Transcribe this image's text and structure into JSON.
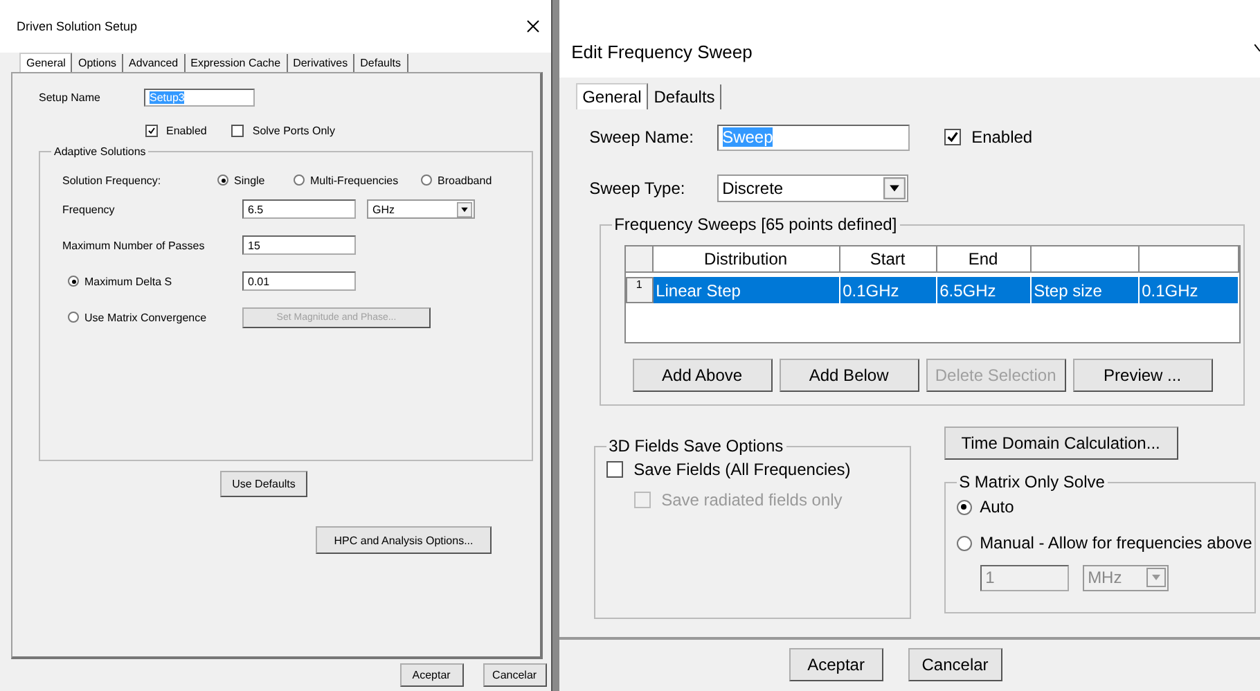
{
  "left_dialog": {
    "title": "Driven Solution Setup",
    "tabs": [
      {
        "label": "General",
        "selected": true
      },
      {
        "label": "Options",
        "selected": false
      },
      {
        "label": "Advanced",
        "selected": false
      },
      {
        "label": "Expression Cache",
        "selected": false
      },
      {
        "label": "Derivatives",
        "selected": false
      },
      {
        "label": "Defaults",
        "selected": false
      }
    ],
    "setup_name": {
      "label": "Setup Name",
      "value": "Setup3",
      "text_selected": true
    },
    "checkboxes": [
      {
        "label": "Enabled",
        "checked": true
      },
      {
        "label": "Solve Ports Only",
        "checked": false
      }
    ],
    "adaptive": {
      "title": "Adaptive Solutions",
      "solution_frequency": {
        "label": "Solution Frequency:",
        "options": [
          {
            "label": "Single",
            "selected": true
          },
          {
            "label": "Multi-Frequencies",
            "selected": false
          },
          {
            "label": "Broadband",
            "selected": false
          }
        ]
      },
      "frequency": {
        "label": "Frequency",
        "value": "6.5",
        "unit": "GHz"
      },
      "max_passes": {
        "label": "Maximum Number of Passes",
        "value": "15"
      },
      "criteria": [
        {
          "kind": "field",
          "label": "Maximum Delta S",
          "selected": true,
          "value": "0.01"
        },
        {
          "kind": "button",
          "label": "Use Matrix Convergence",
          "selected": false,
          "button": "Set Magnitude and Phase...",
          "disabled": true
        }
      ]
    },
    "use_defaults": "Use Defaults",
    "hpc": "HPC and Analysis Options...",
    "buttons": [
      "Aceptar",
      "Cancelar"
    ]
  },
  "right_dialog": {
    "title": "Edit Frequency Sweep",
    "tabs": [
      {
        "label": "General",
        "selected": true
      },
      {
        "label": "Defaults",
        "selected": false
      }
    ],
    "sweep_name": {
      "label": "Sweep Name:",
      "value": "Sweep",
      "text_selected": true
    },
    "enabled": {
      "label": "Enabled",
      "checked": true
    },
    "sweep_type": {
      "label": "Sweep Type:",
      "value": "Discrete"
    },
    "sweeps": {
      "title": "Frequency Sweeps [65 points defined]",
      "columns": [
        "Distribution",
        "Start",
        "End"
      ],
      "rows": [
        {
          "number": "1",
          "selected": true,
          "cells": [
            "Linear Step",
            "0.1GHz",
            "6.5GHz",
            "Step size",
            "0.1GHz"
          ]
        }
      ],
      "actions": [
        {
          "label": "Add Above",
          "disabled": false
        },
        {
          "label": "Add Below",
          "disabled": false
        },
        {
          "label": "Delete Selection",
          "disabled": true
        },
        {
          "label": "Preview ...",
          "disabled": false
        }
      ]
    },
    "fields_save": {
      "title": "3D Fields Save Options",
      "options": [
        {
          "label": "Save Fields (All Frequencies)",
          "checked": false,
          "disabled": false,
          "children": [
            {
              "label": "Save radiated fields only",
              "checked": false,
              "disabled": true
            }
          ]
        }
      ]
    },
    "time_domain": "Time Domain Calculation...",
    "s_matrix": {
      "title": "S Matrix Only Solve",
      "options": [
        {
          "label": "Auto",
          "selected": true
        },
        {
          "label": "Manual -  Allow for frequencies above",
          "selected": false
        }
      ],
      "threshold": {
        "value": "1",
        "unit": "MHz",
        "disabled": true
      }
    },
    "buttons": [
      "Aceptar",
      "Cancelar"
    ]
  }
}
